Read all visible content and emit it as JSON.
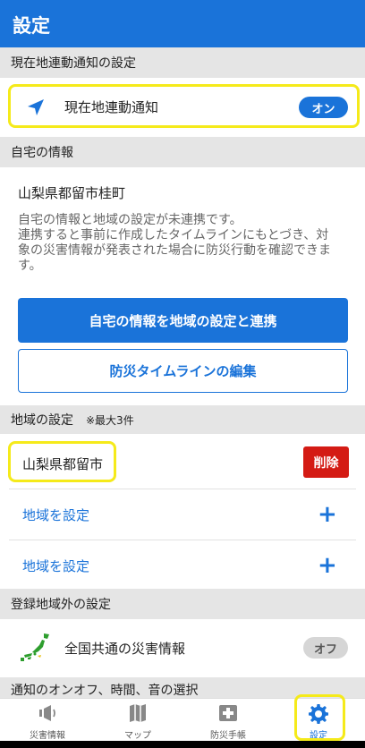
{
  "header": {
    "title": "設定"
  },
  "location_notify": {
    "section_title": "現在地連動通知の設定",
    "label": "現在地連動通知",
    "toggle": "オン"
  },
  "home": {
    "section_title": "自宅の情報",
    "address": "山梨県都留市桂町",
    "description_lines": [
      "自宅の情報と地域の設定が未連携です。",
      "連携すると事前に作成したタイムラインにもとづき、対",
      "象の災害情報が発表された場合に防災行動を確認できま",
      "す。"
    ],
    "link_button": "自宅の情報を地域の設定と連携",
    "timeline_button": "防災タイムラインの編集"
  },
  "regions": {
    "section_title": "地域の設定",
    "section_note": "※最大3件",
    "items": [
      {
        "name": "山梨県都留市",
        "delete": "削除"
      }
    ],
    "add_label_1": "地域を設定",
    "add_label_2": "地域を設定"
  },
  "outside": {
    "section_title": "登録地域外の設定",
    "label": "全国共通の災害情報",
    "toggle": "オフ"
  },
  "notify_section": {
    "section_title": "通知のオンオフ、時間、音の選択"
  },
  "nav": {
    "items": [
      {
        "label": "災害情報",
        "icon": "speaker-icon"
      },
      {
        "label": "マップ",
        "icon": "map-icon"
      },
      {
        "label": "防災手帳",
        "icon": "first-aid-icon"
      },
      {
        "label": "設定",
        "icon": "gear-icon"
      }
    ]
  },
  "colors": {
    "accent": "#1a73d9",
    "danger": "#d41b14",
    "highlight": "#f5ea1a",
    "section_bg": "#e5e5e5"
  }
}
